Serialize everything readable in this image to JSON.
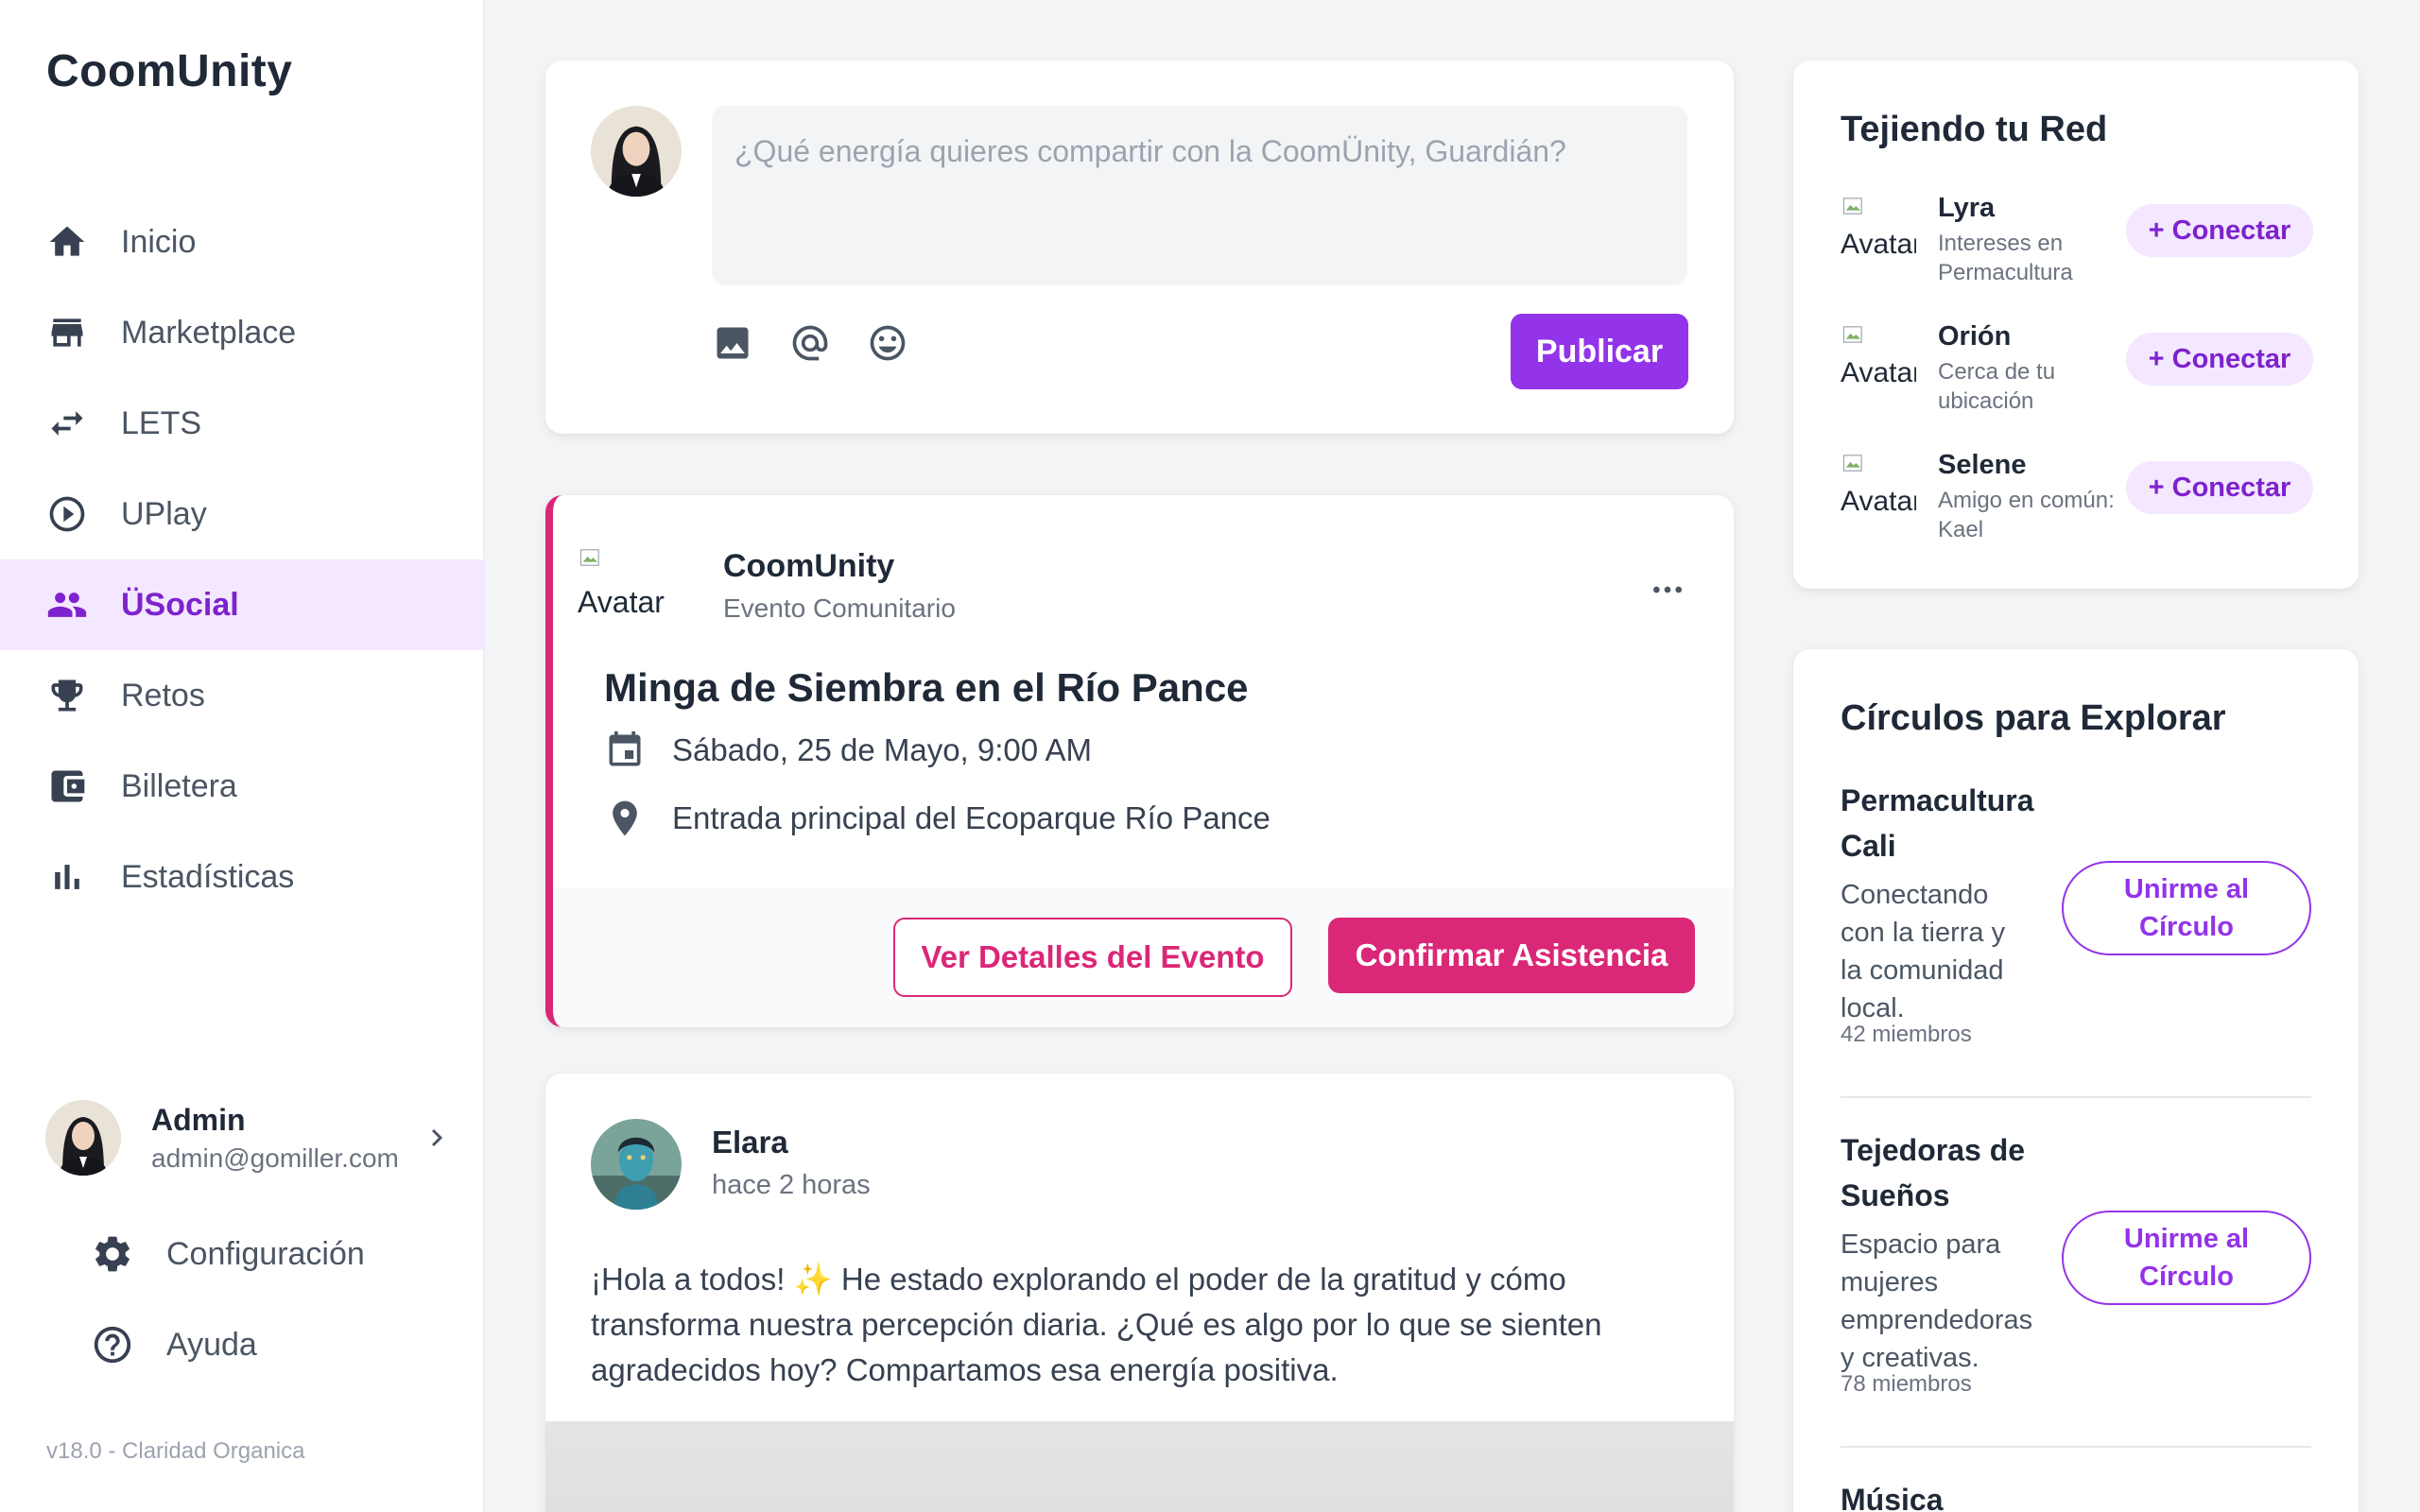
{
  "app": {
    "name": "CoomUnity",
    "version": "v18.0 - Claridad Organica"
  },
  "sidebar": {
    "items": [
      {
        "label": "Inicio",
        "icon": "home-icon",
        "active": false
      },
      {
        "label": "Marketplace",
        "icon": "store-icon",
        "active": false
      },
      {
        "label": "LETS",
        "icon": "swap-icon",
        "active": false
      },
      {
        "label": "UPlay",
        "icon": "play-circle-icon",
        "active": false
      },
      {
        "label": "ÜSocial",
        "icon": "people-icon",
        "active": true
      },
      {
        "label": "Retos",
        "icon": "trophy-icon",
        "active": false
      },
      {
        "label": "Billetera",
        "icon": "wallet-icon",
        "active": false
      },
      {
        "label": "Estadísticas",
        "icon": "bar-chart-icon",
        "active": false
      }
    ],
    "user": {
      "name": "Admin",
      "email": "admin@gomiller.com"
    },
    "settings_label": "Configuración",
    "help_label": "Ayuda"
  },
  "composer": {
    "placeholder": "¿Qué energía quieres compartir con la CoomÜnity, Guardián?",
    "publish_label": "Publicar",
    "tools": [
      "image-icon",
      "mention-icon",
      "emoji-icon"
    ]
  },
  "event": {
    "avatar_alt": "Avatar",
    "organizer": "CoomUnity",
    "type": "Evento Comunitario",
    "title": "Minga de Siembra en el Río Pance",
    "date": "Sábado, 25 de Mayo, 9:00 AM",
    "location": "Entrada principal del Ecoparque Río Pance",
    "details_label": "Ver Detalles del Evento",
    "confirm_label": "Confirmar Asistencia",
    "accent": "#db2777"
  },
  "post": {
    "author": "Elara",
    "time": "hace 2 horas",
    "text": "¡Hola a todos! ✨ He estado explorando el poder de la gratitud y cómo transforma nuestra percepción diaria. ¿Qué es algo por lo que se sienten agradecidos hoy? Compartamos esa energía positiva."
  },
  "network": {
    "title": "Tejiendo tu Red",
    "connect_label": "+ Conectar",
    "avatar_alt": "Avatar",
    "suggestions": [
      {
        "name": "Lyra",
        "desc": "Intereses en Permacultura"
      },
      {
        "name": "Orión",
        "desc": "Cerca de tu ubicación"
      },
      {
        "name": "Selene",
        "desc": "Amigo en común: Kael"
      }
    ]
  },
  "circles": {
    "title": "Círculos para Explorar",
    "join_label": "Unirme al Círculo",
    "items": [
      {
        "name": "Permacultura Cali",
        "desc": "Conectando con la tierra y la comunidad local.",
        "members": "42 miembros"
      },
      {
        "name": "Tejedoras de Sueños",
        "desc": "Espacio para mujeres emprendedoras y creativas.",
        "members": "78 miembros"
      },
      {
        "name": "Música"
      }
    ]
  },
  "colors": {
    "primary": "#9333ea",
    "primary_soft": "#f3e8ff",
    "accent": "#db2777"
  }
}
